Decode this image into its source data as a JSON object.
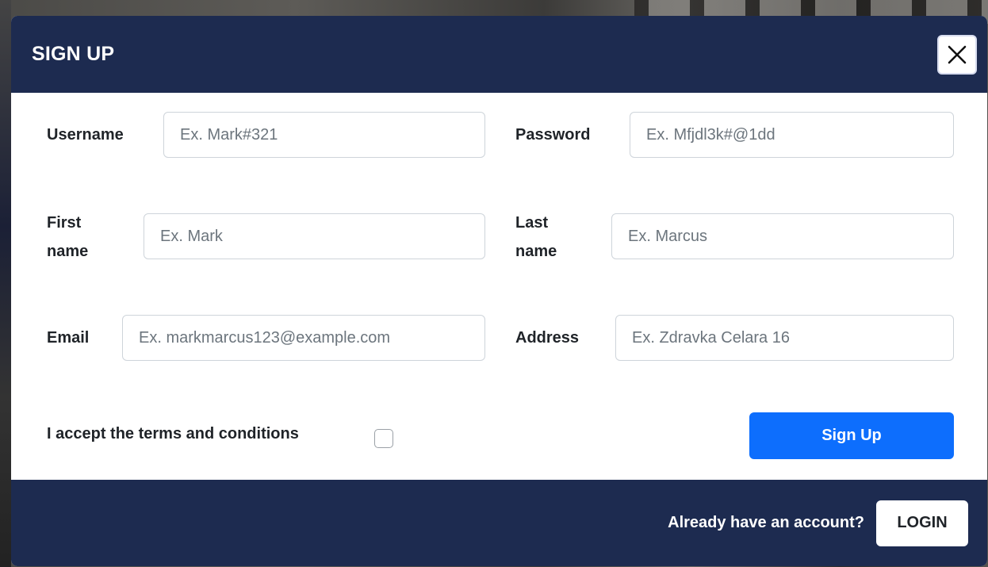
{
  "modal": {
    "title": "SIGN UP",
    "close_icon": "close-icon"
  },
  "form": {
    "username": {
      "label": "Username",
      "placeholder": "Ex. Mark#321",
      "value": ""
    },
    "password": {
      "label": "Password",
      "placeholder": "Ex. Mfjdl3k#@1dd",
      "value": ""
    },
    "first_name": {
      "label_line1": "First",
      "label_line2": "name",
      "placeholder": "Ex. Mark",
      "value": ""
    },
    "last_name": {
      "label_line1": "Last",
      "label_line2": "name",
      "placeholder": "Ex. Marcus",
      "value": ""
    },
    "email": {
      "label": "Email",
      "placeholder": "Ex. markmarcus123@example.com",
      "value": ""
    },
    "address": {
      "label": "Address",
      "placeholder": "Ex. Zdravka Celara 16",
      "value": ""
    },
    "terms": {
      "label": "I accept the terms and conditions",
      "checked": false
    },
    "submit_label": "Sign Up"
  },
  "footer": {
    "prompt": "Already have an account?",
    "login_label": "LOGIN"
  },
  "colors": {
    "header_bg": "#1d2b50",
    "primary": "#0d6efd"
  }
}
